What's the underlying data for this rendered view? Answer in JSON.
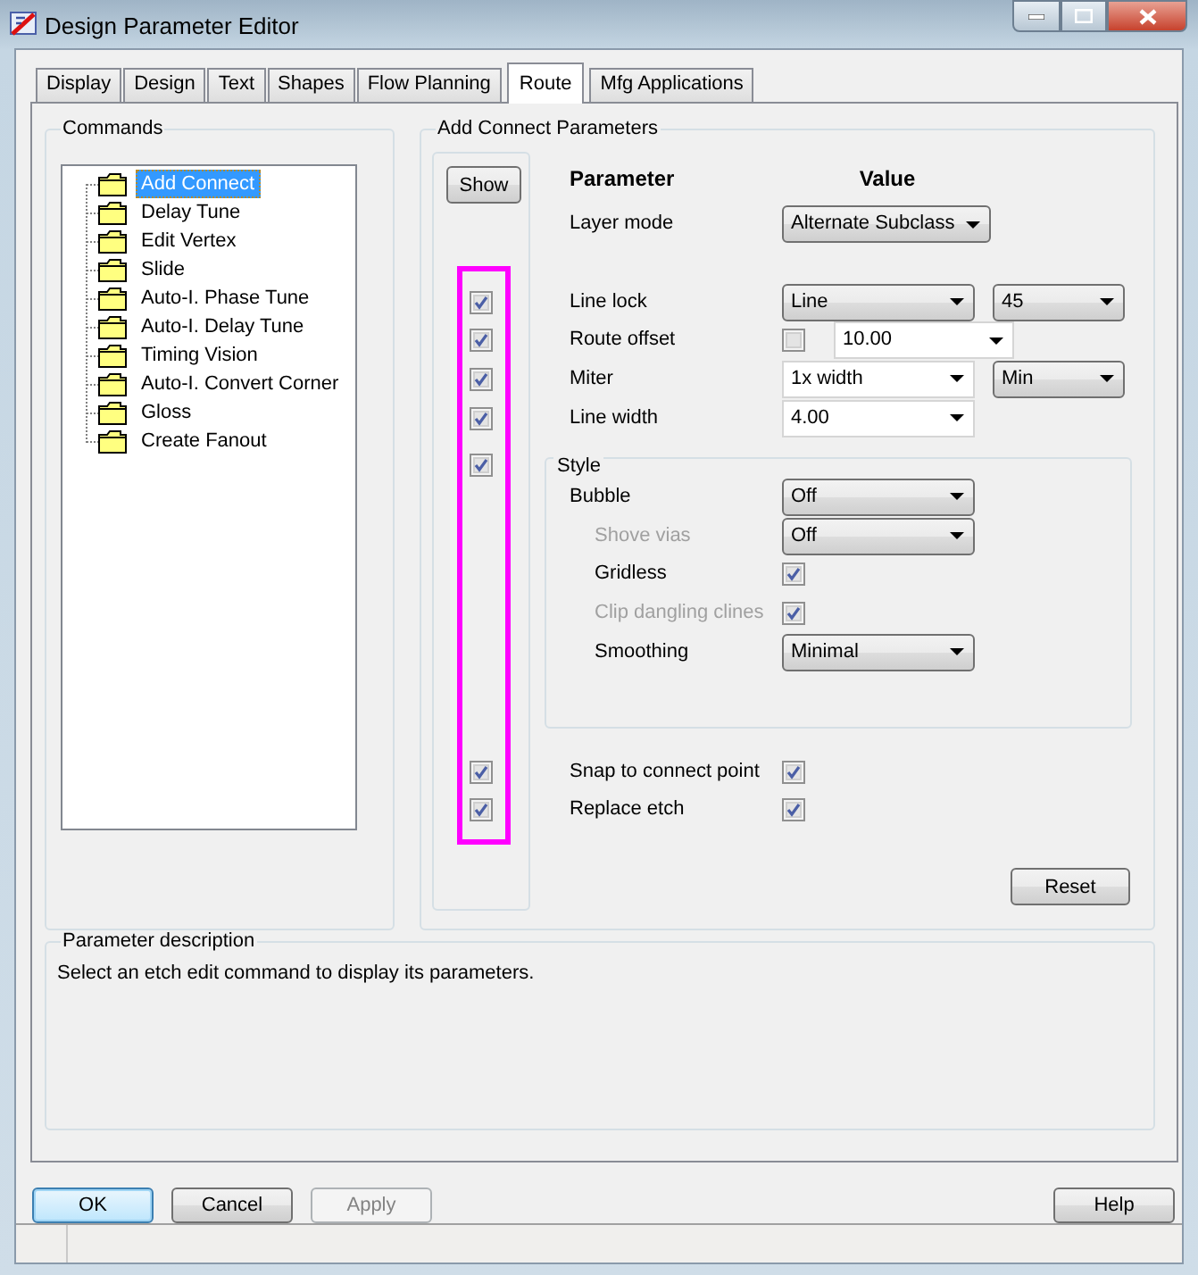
{
  "window": {
    "title": "Design Parameter Editor"
  },
  "tabs": [
    {
      "label": "Display",
      "selected": false
    },
    {
      "label": "Design",
      "selected": false
    },
    {
      "label": "Text",
      "selected": false
    },
    {
      "label": "Shapes",
      "selected": false
    },
    {
      "label": "Flow Planning",
      "selected": false
    },
    {
      "label": "Route",
      "selected": true
    },
    {
      "label": "Mfg Applications",
      "selected": false
    }
  ],
  "commands": {
    "title": "Commands",
    "items": [
      {
        "label": "Add Connect",
        "selected": true
      },
      {
        "label": "Delay Tune",
        "selected": false
      },
      {
        "label": "Edit Vertex",
        "selected": false
      },
      {
        "label": "Slide",
        "selected": false
      },
      {
        "label": "Auto-I. Phase Tune",
        "selected": false
      },
      {
        "label": "Auto-I. Delay Tune",
        "selected": false
      },
      {
        "label": "Timing Vision",
        "selected": false
      },
      {
        "label": "Auto-I. Convert Corner",
        "selected": false
      },
      {
        "label": "Gloss",
        "selected": false
      },
      {
        "label": "Create Fanout",
        "selected": false
      }
    ]
  },
  "parameters": {
    "title": "Add Connect Parameters",
    "show_button": "Show",
    "column_headers": [
      "Parameter",
      "Value"
    ],
    "groups": [
      [
        {
          "label": "Layer mode",
          "disabled": false,
          "controls": [
            {
              "kind": "dropdown",
              "value": "Alternate Subclass"
            }
          ]
        }
      ],
      [
        {
          "label": "Line lock",
          "disabled": false,
          "show": true,
          "controls": [
            {
              "kind": "dropdown",
              "value": "Line"
            },
            {
              "kind": "dropdown",
              "value": "45"
            }
          ]
        },
        {
          "label": "Route offset",
          "disabled": false,
          "show": true,
          "controls": [
            {
              "kind": "checkbox",
              "checked": false
            },
            {
              "kind": "combo",
              "value": "10.00"
            }
          ]
        },
        {
          "label": "Miter",
          "disabled": false,
          "show": true,
          "controls": [
            {
              "kind": "combo",
              "value": "1x width"
            },
            {
              "kind": "dropdown",
              "value": "Min"
            }
          ]
        },
        {
          "label": "Line width",
          "disabled": false,
          "show": true,
          "controls": [
            {
              "kind": "combo",
              "value": "4.00"
            }
          ]
        }
      ]
    ],
    "style": {
      "title": "Style",
      "show": true,
      "rows": [
        {
          "label": "Bubble",
          "disabled": false,
          "indented": false,
          "controls": [
            {
              "kind": "dropdown",
              "value": "Off"
            }
          ]
        },
        {
          "label": "Shove vias",
          "disabled": true,
          "indented": true,
          "controls": [
            {
              "kind": "dropdown",
              "value": "Off"
            }
          ]
        },
        {
          "label": "Gridless",
          "disabled": false,
          "indented": true,
          "controls": [
            {
              "kind": "checkbox",
              "checked": true
            }
          ]
        },
        {
          "label": "Clip dangling clines",
          "disabled": true,
          "indented": true,
          "controls": [
            {
              "kind": "checkbox",
              "checked": true
            }
          ]
        },
        {
          "label": "Smoothing",
          "disabled": false,
          "indented": true,
          "controls": [
            {
              "kind": "dropdown",
              "value": "Minimal"
            }
          ]
        }
      ]
    },
    "bottom_rows": [
      {
        "label": "Snap to connect point",
        "disabled": false,
        "show": true,
        "controls": [
          {
            "kind": "checkbox",
            "checked": true
          }
        ]
      },
      {
        "label": "Replace etch",
        "disabled": false,
        "show": true,
        "controls": [
          {
            "kind": "checkbox",
            "checked": true
          }
        ]
      }
    ],
    "reset_button": "Reset"
  },
  "description": {
    "title": "Parameter description",
    "text": "Select an etch edit command to display its parameters."
  },
  "buttons": [
    {
      "label": "OK",
      "default": true,
      "disabled": false
    },
    {
      "label": "Cancel",
      "default": false,
      "disabled": false
    },
    {
      "label": "Apply",
      "default": false,
      "disabled": true
    },
    {
      "label": "Help",
      "default": false,
      "disabled": false
    }
  ]
}
